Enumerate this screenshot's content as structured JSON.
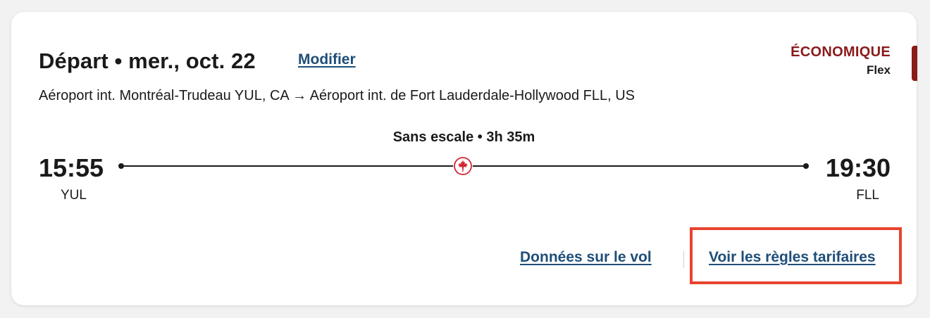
{
  "flight": {
    "title": "Départ • mer., oct. 22",
    "modify_label": "Modifier",
    "route": "Aéroport int. Montréal-Trudeau YUL, CA → Aéroport int. de Fort Lauderdale-Hollywood FLL, US",
    "cabin": "ÉCONOMIQUE",
    "fare": "Flex",
    "duration": "Sans escale • 3h 35m",
    "departure": {
      "time": "15:55",
      "code": "YUL"
    },
    "arrival": {
      "time": "19:30",
      "code": "FLL"
    }
  },
  "links": {
    "flight_data": "Données sur le vol",
    "fare_rules": "Voir les règles tarifaires"
  },
  "icons": {
    "airline": "maple-leaf-icon"
  },
  "colors": {
    "cabin": "#8b1a1a",
    "link": "#1f4e79",
    "maple": "#d22630",
    "highlight": "#e8432e"
  }
}
